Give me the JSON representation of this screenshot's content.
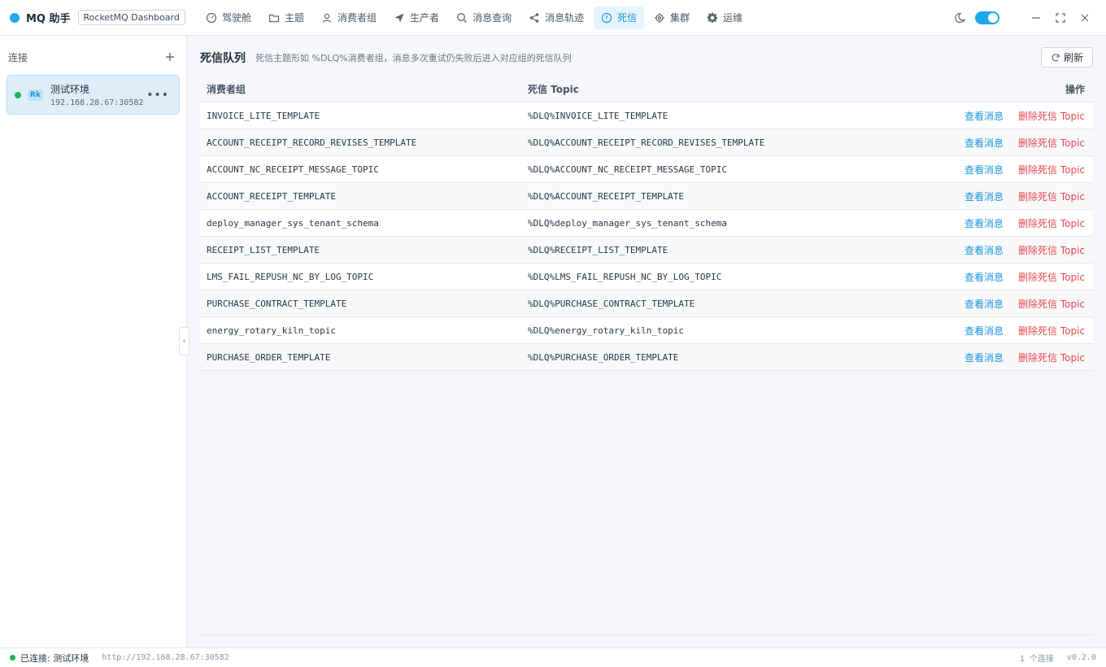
{
  "app": {
    "name": "MQ 助手",
    "tag": "RocketMQ Dashboard"
  },
  "nav": [
    {
      "label": "驾驶舱",
      "icon": "gauge-icon",
      "active": false
    },
    {
      "label": "主题",
      "icon": "folder-icon",
      "active": false
    },
    {
      "label": "消费者组",
      "icon": "user-icon",
      "active": false
    },
    {
      "label": "生产者",
      "icon": "send-icon",
      "active": false
    },
    {
      "label": "消息查询",
      "icon": "search-icon",
      "active": false
    },
    {
      "label": "消息轨迹",
      "icon": "share-icon",
      "active": false
    },
    {
      "label": "死信",
      "icon": "alert-circle-icon",
      "active": true
    },
    {
      "label": "集群",
      "icon": "cpu-icon",
      "active": false
    },
    {
      "label": "运维",
      "icon": "gear-icon",
      "active": false
    }
  ],
  "sidebar": {
    "title": "连接",
    "connections": [
      {
        "name": "测试环境",
        "badge": "Rk",
        "address": "192.168.28.67:30582",
        "status": "connected"
      }
    ]
  },
  "page": {
    "title": "死信队列",
    "description": "死信主题形如 %DLQ%消费者组，消息多次重试仍失败后进入对应组的死信队列",
    "refresh_label": "刷新"
  },
  "table": {
    "columns": [
      "消费者组",
      "死信 Topic",
      "操作"
    ],
    "actions": {
      "view": "查看消息",
      "delete": "删除死信 Topic"
    },
    "rows": [
      {
        "group": "INVOICE_LITE_TEMPLATE",
        "topic": "%DLQ%INVOICE_LITE_TEMPLATE"
      },
      {
        "group": "ACCOUNT_RECEIPT_RECORD_REVISES_TEMPLATE",
        "topic": "%DLQ%ACCOUNT_RECEIPT_RECORD_REVISES_TEMPLATE"
      },
      {
        "group": "ACCOUNT_NC_RECEIPT_MESSAGE_TOPIC",
        "topic": "%DLQ%ACCOUNT_NC_RECEIPT_MESSAGE_TOPIC"
      },
      {
        "group": "ACCOUNT_RECEIPT_TEMPLATE",
        "topic": "%DLQ%ACCOUNT_RECEIPT_TEMPLATE"
      },
      {
        "group": "deploy_manager_sys_tenant_schema",
        "topic": "%DLQ%deploy_manager_sys_tenant_schema"
      },
      {
        "group": "RECEIPT_LIST_TEMPLATE",
        "topic": "%DLQ%RECEIPT_LIST_TEMPLATE"
      },
      {
        "group": "LMS_FAIL_REPUSH_NC_BY_LOG_TOPIC",
        "topic": "%DLQ%LMS_FAIL_REPUSH_NC_BY_LOG_TOPIC"
      },
      {
        "group": "PURCHASE_CONTRACT_TEMPLATE",
        "topic": "%DLQ%PURCHASE_CONTRACT_TEMPLATE"
      },
      {
        "group": "energy_rotary_kiln_topic",
        "topic": "%DLQ%energy_rotary_kiln_topic"
      },
      {
        "group": "PURCHASE_ORDER_TEMPLATE",
        "topic": "%DLQ%PURCHASE_ORDER_TEMPLATE"
      }
    ]
  },
  "statusbar": {
    "status": "已连接: 测试环境",
    "url": "http://192.168.28.67:30582",
    "count": "1 个连接",
    "version": "v0.2.0"
  },
  "colors": {
    "accent": "#1ea7ea",
    "danger": "#e5484d",
    "online": "#1bb356"
  }
}
